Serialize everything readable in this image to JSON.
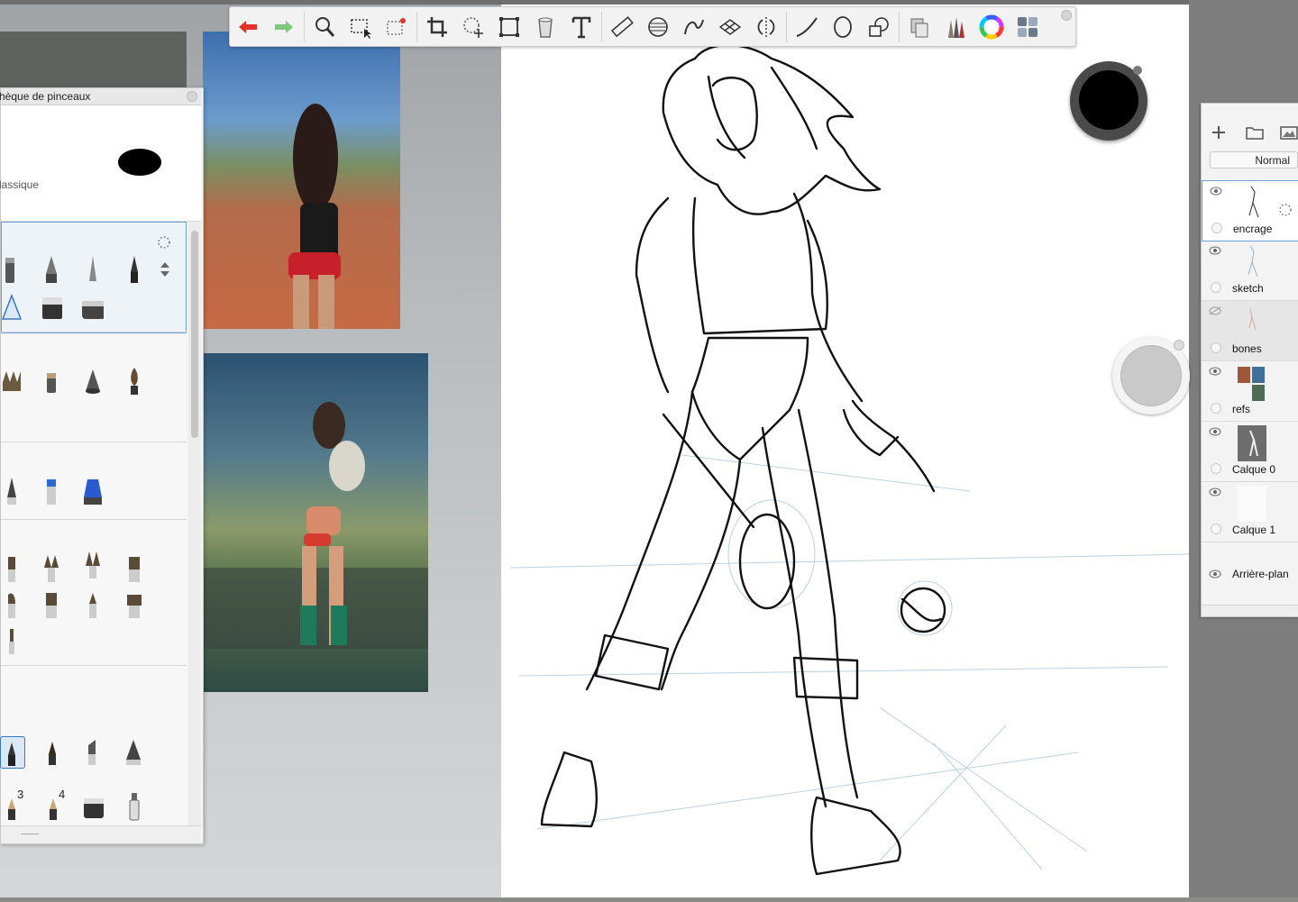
{
  "toolbar": {
    "tools": [
      {
        "name": "undo-icon"
      },
      {
        "name": "redo-icon"
      },
      {
        "name": "zoom-icon"
      },
      {
        "name": "select-icon"
      },
      {
        "name": "magic-select-icon"
      },
      {
        "name": "crop-icon"
      },
      {
        "name": "lasso-transform-icon"
      },
      {
        "name": "transform-icon"
      },
      {
        "name": "fill-bucket-icon"
      },
      {
        "name": "text-icon"
      },
      {
        "name": "ruler-icon"
      },
      {
        "name": "ellipse-guide-icon"
      },
      {
        "name": "french-curve-icon"
      },
      {
        "name": "perspective-icon"
      },
      {
        "name": "symmetry-icon"
      },
      {
        "name": "stroke-line-icon"
      },
      {
        "name": "ellipse-icon"
      },
      {
        "name": "shape-icon"
      },
      {
        "name": "copy-paste-icon"
      },
      {
        "name": "brush-library-icon"
      },
      {
        "name": "color-wheel-icon"
      },
      {
        "name": "layers-toggle-icon"
      }
    ]
  },
  "brush_library": {
    "title": "hèque de pinceaux",
    "preset_label": "lassique",
    "set_numbers": [
      "3",
      "4"
    ]
  },
  "layers": {
    "blend_mode": "Normal",
    "items": [
      {
        "name": "encrage",
        "visible": true,
        "selected": true
      },
      {
        "name": "sketch",
        "visible": true,
        "selected": false
      },
      {
        "name": "bones",
        "visible": false,
        "selected": false
      },
      {
        "name": "refs",
        "visible": true,
        "selected": false
      },
      {
        "name": "Calque 0",
        "visible": true,
        "selected": false
      },
      {
        "name": "Calque 1",
        "visible": true,
        "selected": false
      },
      {
        "name": "Arrière-plan",
        "visible": true,
        "selected": false
      }
    ]
  },
  "colors": {
    "current_color": "#000000",
    "secondary_puck": "#c9c9c9",
    "selection_accent": "#6aa0d6"
  }
}
